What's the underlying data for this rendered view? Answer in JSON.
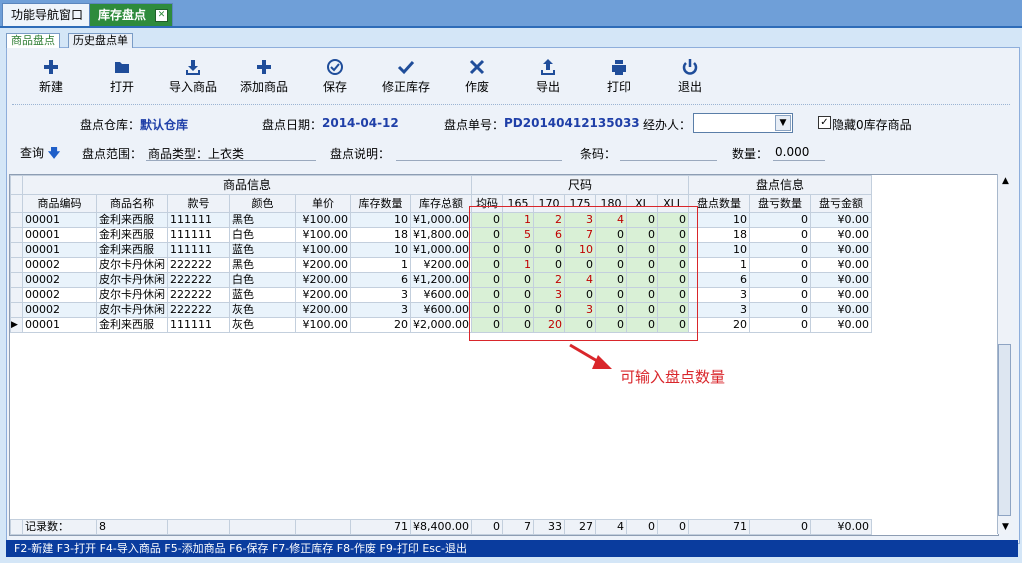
{
  "window_tabs": {
    "nav": "功能导航窗口",
    "active": "库存盘点"
  },
  "sub_tabs": {
    "current": "商品盘点",
    "history": "历史盘点单"
  },
  "toolbar": {
    "new": "新建",
    "open": "打开",
    "import": "导入商品",
    "add": "添加商品",
    "save": "保存",
    "fix": "修正库存",
    "void": "作废",
    "export": "导出",
    "print": "打印",
    "exit": "退出"
  },
  "form": {
    "warehouse_label": "盘点仓库：",
    "warehouse": "默认仓库",
    "date_label": "盘点日期：",
    "date": "2014-04-12",
    "no_label": "盘点单号：",
    "no": "PD20140412135033",
    "handler_label": "经办人：",
    "hide_zero": "隐藏0库存商品",
    "query": "查询",
    "range_label": "盘点范围：",
    "range": "商品类型：上衣类",
    "desc_label": "盘点说明：",
    "barcode_label": "条码：",
    "qty_label": "数量：",
    "qty": "0.000"
  },
  "table": {
    "group_headers": {
      "info": "商品信息",
      "size": "尺码",
      "check": "盘点信息"
    },
    "columns": [
      "商品编码",
      "商品名称",
      "款号",
      "颜色",
      "单价",
      "库存数量",
      "库存总额",
      "均码",
      "165",
      "170",
      "175",
      "180",
      "XL",
      "XLL",
      "盘点数量",
      "盘亏数量",
      "盘亏金额"
    ],
    "rows": [
      [
        "00001",
        "金利来西服",
        "111111",
        "黑色",
        "¥100.00",
        "10",
        "¥1,000.00",
        "0",
        "1",
        "2",
        "3",
        "4",
        "0",
        "0",
        "10",
        "0",
        "¥0.00"
      ],
      [
        "00001",
        "金利来西服",
        "111111",
        "白色",
        "¥100.00",
        "18",
        "¥1,800.00",
        "0",
        "5",
        "6",
        "7",
        "0",
        "0",
        "0",
        "18",
        "0",
        "¥0.00"
      ],
      [
        "00001",
        "金利来西服",
        "111111",
        "蓝色",
        "¥100.00",
        "10",
        "¥1,000.00",
        "0",
        "0",
        "0",
        "10",
        "0",
        "0",
        "0",
        "10",
        "0",
        "¥0.00"
      ],
      [
        "00002",
        "皮尔卡丹休闲",
        "222222",
        "黑色",
        "¥200.00",
        "1",
        "¥200.00",
        "0",
        "1",
        "0",
        "0",
        "0",
        "0",
        "0",
        "1",
        "0",
        "¥0.00"
      ],
      [
        "00002",
        "皮尔卡丹休闲",
        "222222",
        "白色",
        "¥200.00",
        "6",
        "¥1,200.00",
        "0",
        "0",
        "2",
        "4",
        "0",
        "0",
        "0",
        "6",
        "0",
        "¥0.00"
      ],
      [
        "00002",
        "皮尔卡丹休闲",
        "222222",
        "蓝色",
        "¥200.00",
        "3",
        "¥600.00",
        "0",
        "0",
        "3",
        "0",
        "0",
        "0",
        "0",
        "3",
        "0",
        "¥0.00"
      ],
      [
        "00002",
        "皮尔卡丹休闲",
        "222222",
        "灰色",
        "¥200.00",
        "3",
        "¥600.00",
        "0",
        "0",
        "0",
        "3",
        "0",
        "0",
        "0",
        "3",
        "0",
        "¥0.00"
      ],
      [
        "00001",
        "金利来西服",
        "111111",
        "灰色",
        "¥100.00",
        "20",
        "¥2,000.00",
        "0",
        "0",
        "20",
        "0",
        "0",
        "0",
        "0",
        "20",
        "0",
        "¥0.00"
      ]
    ],
    "footer": {
      "label": "记录数：",
      "count": "8",
      "stock_qty": "71",
      "stock_total": "¥8,400.00",
      "sizes": [
        "0",
        "7",
        "33",
        "27",
        "4",
        "0",
        "0"
      ],
      "check_qty": "71",
      "loss_qty": "0",
      "loss_amt": "¥0.00"
    }
  },
  "annotation": "可输入盘点数量",
  "status_bar": "F2-新建 F3-打开 F4-导入商品 F5-添加商品 F6-保存 F7-修正库存 F8-作废 F9-打印 Esc-退出",
  "colors": {
    "accent_green": "#2e8b3c",
    "status_blue": "#0a3c9e",
    "highlight_red": "#d9262b"
  }
}
